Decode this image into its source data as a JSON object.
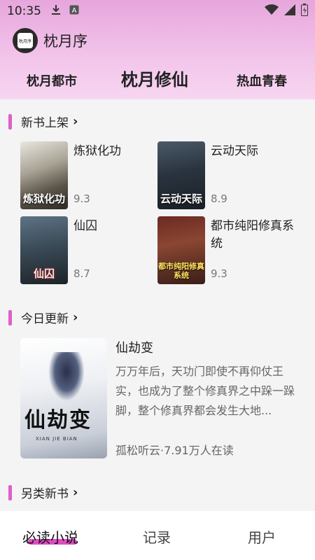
{
  "status_bar": {
    "time": "10:35"
  },
  "app": {
    "title": "枕月序",
    "logo_text": "枕月序"
  },
  "top_tabs": [
    {
      "label": "枕月都市",
      "active": false
    },
    {
      "label": "枕月修仙",
      "active": true
    },
    {
      "label": "热血青春",
      "active": false
    }
  ],
  "sections": {
    "new_books": {
      "title": "新书上架",
      "books": [
        {
          "name": "炼狱化功",
          "score": "9.3",
          "cover_text": "炼狱化功"
        },
        {
          "name": "云动天际",
          "score": "8.9",
          "cover_text": "云动天际"
        },
        {
          "name": "仙囚",
          "score": "8.7",
          "cover_text": "仙囚"
        },
        {
          "name": "都市纯阳修真系统",
          "score": "9.3",
          "cover_text": "都市纯阳修真系统"
        }
      ]
    },
    "today_update": {
      "title": "今日更新",
      "featured": {
        "name": "仙劫变",
        "desc": "万万年后，天功门即使不再仰仗王实，也成为了整个修真界之中跺一跺脚，整个修真界都会发生大地...",
        "meta": "孤松听云·7.91万人在读",
        "cover_title": "仙劫变",
        "cover_pinyin": "XIAN JIE BIAN"
      }
    },
    "other_new": {
      "title": "另类新书"
    }
  },
  "bottom_nav": [
    {
      "label": "必读小说",
      "active": true
    },
    {
      "label": "记录",
      "active": false
    },
    {
      "label": "用户",
      "active": false
    }
  ],
  "colors": {
    "accent": "#e04bc3",
    "header_top": "#e6a6dc",
    "header_bottom": "#f7d6f1",
    "section_bar": "#df5fc8"
  }
}
